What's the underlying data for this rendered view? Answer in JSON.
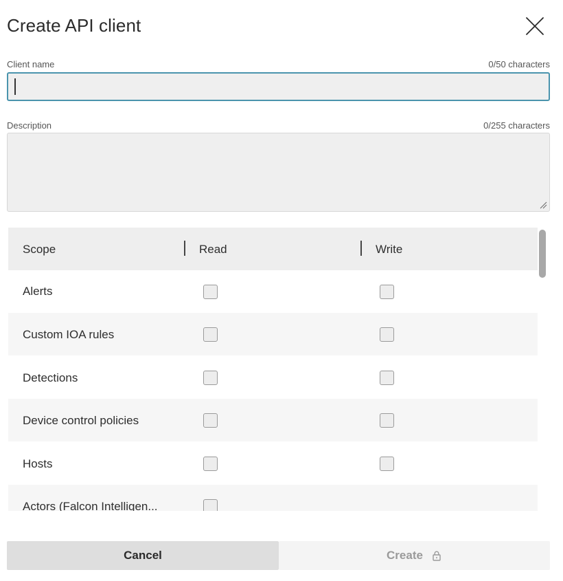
{
  "dialog": {
    "title": "Create API client",
    "close_icon": "close-icon"
  },
  "client_name": {
    "label": "Client name",
    "counter": "0/50 characters",
    "value": ""
  },
  "description": {
    "label": "Description",
    "counter": "0/255 characters",
    "value": ""
  },
  "scopes_table": {
    "headers": {
      "scope": "Scope",
      "read": "Read",
      "write": "Write"
    },
    "rows": [
      {
        "label": "Alerts",
        "read": false,
        "write": false,
        "has_write": true
      },
      {
        "label": "Custom IOA rules",
        "read": false,
        "write": false,
        "has_write": true
      },
      {
        "label": "Detections",
        "read": false,
        "write": false,
        "has_write": true
      },
      {
        "label": "Device control policies",
        "read": false,
        "write": false,
        "has_write": true
      },
      {
        "label": "Hosts",
        "read": false,
        "write": false,
        "has_write": true
      },
      {
        "label": "Actors (Falcon Intelligen...",
        "read": false,
        "write": false,
        "has_write": false
      }
    ]
  },
  "actions": {
    "cancel_label": "Cancel",
    "create_label": "Create",
    "create_icon": "lock-icon"
  }
}
